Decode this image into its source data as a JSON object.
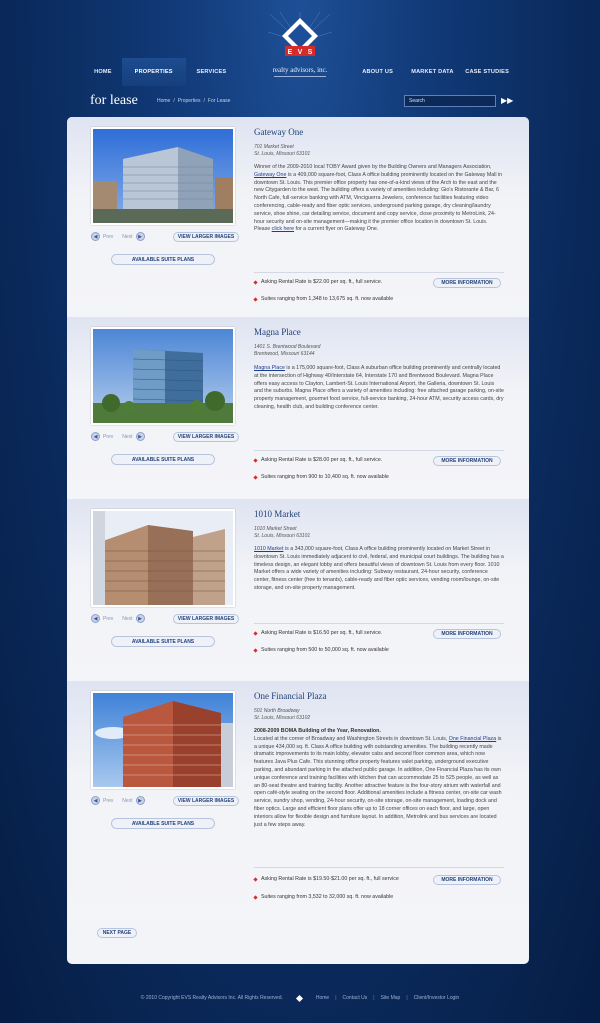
{
  "nav": {
    "items": [
      {
        "label": "HOME"
      },
      {
        "label": "PROPERTIES"
      },
      {
        "label": "SERVICES"
      },
      {
        "label": "ABOUT US"
      },
      {
        "label": "MARKET DATA"
      },
      {
        "label": "CASE STUDIES"
      }
    ],
    "active_index": 1
  },
  "logo": {
    "letters": "EVS",
    "tagline": "realty advisors, inc."
  },
  "page": {
    "title": "for lease"
  },
  "breadcrumb": [
    "Home",
    "/",
    "Properties",
    "/",
    "For Lease"
  ],
  "search": {
    "placeholder": "Search"
  },
  "buttons": {
    "prev": "Prev",
    "next": "Next",
    "view_larger": "VIEW LARGER IMAGES",
    "suite_plans": "AVAILABLE SUITE PLANS",
    "more_info": "MORE INFORMATION",
    "next_page": "NEXT PAGE"
  },
  "properties": [
    {
      "name": "Gateway One",
      "address1": "701 Market Street",
      "address2": "St. Louis, Missouri 63101",
      "desc_lead": "Winner of the 2009-2010 local TOBY Award given by the Building Owners and Managers Association, ",
      "desc_link": "Gateway One",
      "desc_rest": " is a 409,000 square-foot, Class A office building prominently located on the Gateway Mall in downtown St. Louis. This premier office property has one-of-a-kind views of the Arch to the east and the new Citygarden to the west. The building offers a variety of amenities including: Gio's Ristorante & Bar, 6 North Cafe, full-service banking with ATM, Vinciguerra Jewelers, conference facilities featuring video conferencing, cable-ready and fiber optic services, underground parking garage, dry cleaning/laundry service, shoe shine, car detailing service, document and copy service, close proximity to MetroLink, 24-hour security and on-site management—making it the premier office location in downtown St. Louis. Please ",
      "desc_link2": "click here",
      "desc_tail": " for a current flyer on Gateway One.",
      "rate": "Asking Rental Rate is $22.00 per sq. ft., full service.",
      "suites": "Suites ranging from 1,348 to 13,675 sq. ft. now available"
    },
    {
      "name": "Magna Place",
      "address1": "1401 S. Brentwood Boulevard",
      "address2": "Brentwood, Missouri 63144",
      "desc_lead": "",
      "desc_link": "Magna Place",
      "desc_rest": " is a 175,000 square-foot, Class A suburban office building prominently and centrally located at the intersection of Highway 40/Interstate 64, Interstate 170 and Brentwood Boulevard. Magna Place offers easy access to Clayton, Lambert-St. Louis International Airport, the Galleria, downtown St. Louis and the suburbs. Magna Place offers a variety of amenities including: free attached garage parking, on-site property management, gourmet food service, full-service banking, 24-hour ATM, security access cards, dry cleaning, health club, and building conference center.",
      "desc_link2": "",
      "desc_tail": "",
      "rate": "Asking Rental Rate is $28.00 per sq. ft., full service.",
      "suites": "Suites ranging from 900 to 10,400 sq. ft. now available"
    },
    {
      "name": "1010 Market",
      "address1": "1010 Market Street",
      "address2": "St. Louis, Missouri 63101",
      "desc_lead": "",
      "desc_link": "1010 Market",
      "desc_rest": " is a 343,000 square-foot, Class A office building prominently located on Market Street in downtown St. Louis immediately adjacent to civil, federal, and municipal court buildings. The building has a timeless design, an elegant lobby and offers beautiful views of downtown St. Louis from every floor. 1010 Market offers a wide variety of amenities including: Subway restaurant, 24-hour security, conference center, fitness center (free to tenants), cable-ready and fiber optic services, vending room/lounge, on-site storage, and on-site property management.",
      "desc_link2": "",
      "desc_tail": "",
      "rate": "Asking Rental Rate is $16.50 per sq. ft., full service.",
      "suites": "Suites ranging from 500 to 50,000 sq. ft. now available"
    },
    {
      "name": "One Financial Plaza",
      "address1": "501 North Broadway",
      "address2": "St. Louis, Missouri 63102",
      "award": "2008-2009 BOMA Building of the Year, Renovation.",
      "desc_lead": "Located at the corner of Broadway and Washington Streets in downtown St. Louis, ",
      "desc_link": "One Financial Plaza",
      "desc_rest": " is a unique 434,000 sq. ft. Class A office building with outstanding amenities. The building recently made dramatic improvements to its main lobby, elevator cabs and second floor common area, which now features Java Plus Cafe. This stunning office property features valet parking, underground executive parking, and abundant parking in the attached public garage. In addition, One Financial Plaza has its own unique conference and training facilities with kitchen that can accommodate 25 to 525 people, as well as an 80-seat theatre and training facility. Another attractive feature is the four-story atrium with waterfall and open café-style seating on the second floor. Additional amenities include a fitness center, on-site car wash service, sundry shop, vending, 24-hour security, on-site storage, on-site management, loading dock and fiber optics. Large and efficient floor plans offer up to 18 corner offices on each floor, and large, open interiors allow for flexible design and furniture layout. In addition, Metrolink and bus services are located just a few steps away.",
      "desc_link2": "",
      "desc_tail": "",
      "rate": "Asking Rental Rate is $19.50-$21.00 per sq. ft., full service",
      "suites": "Suites ranging from 3,532 to 32,000 sq. ft. now available"
    }
  ],
  "footer": {
    "copyright": "© 2010 Copyright EVS Realty Advisors Inc. All Rights Reserved.",
    "links": [
      "Home",
      "Contact Us",
      "Site Map",
      "Client/Investor Login"
    ]
  },
  "colors": {
    "brand_navy": "#0a2a5c",
    "accent_red": "#e02828",
    "link_blue": "#1e3f8f"
  }
}
